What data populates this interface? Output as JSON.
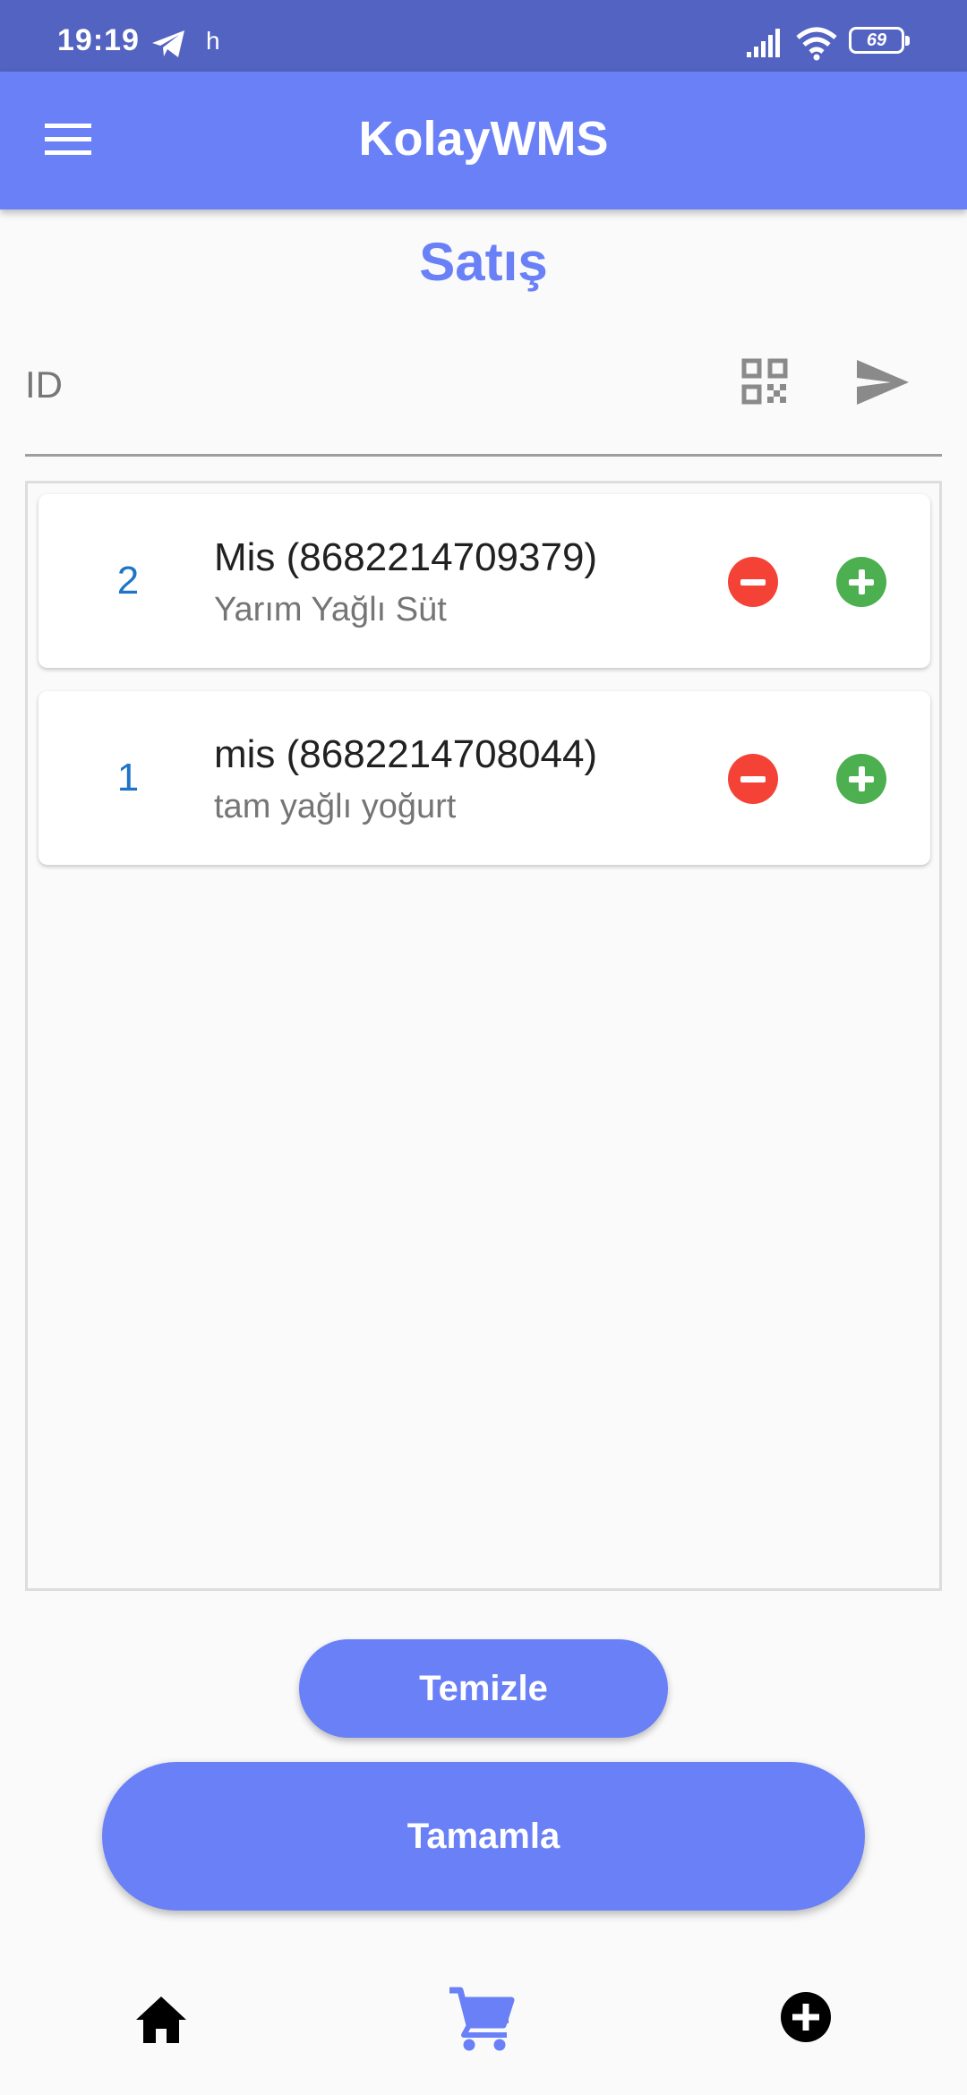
{
  "status_bar": {
    "time": "19:19",
    "notification_letter": "h",
    "battery": "69"
  },
  "app_bar": {
    "title": "KolayWMS",
    "menu_icon": "menu-icon",
    "color": "#6a80f7"
  },
  "page": {
    "title": "Satış"
  },
  "id_field": {
    "placeholder": "ID",
    "value": "",
    "qr_icon": "qr-code-icon",
    "send_icon": "send-icon"
  },
  "items": [
    {
      "quantity": "2",
      "title": "Mis (8682214709379)",
      "subtitle": "Yarım Yağlı Süt"
    },
    {
      "quantity": "1",
      "title": "mis (8682214708044)",
      "subtitle": "tam yağlı yoğurt"
    }
  ],
  "buttons": {
    "clear_label": "Temizle",
    "complete_label": "Tamamla"
  },
  "bottom_nav": {
    "items": [
      {
        "icon": "home-icon",
        "active": false
      },
      {
        "icon": "cart-icon",
        "active": true
      },
      {
        "icon": "add-circle-icon",
        "active": false
      }
    ],
    "active_color": "#6a80f7"
  },
  "colors": {
    "minus": "#f44336",
    "plus": "#4caf50",
    "quantity_text": "#1e74c7"
  }
}
